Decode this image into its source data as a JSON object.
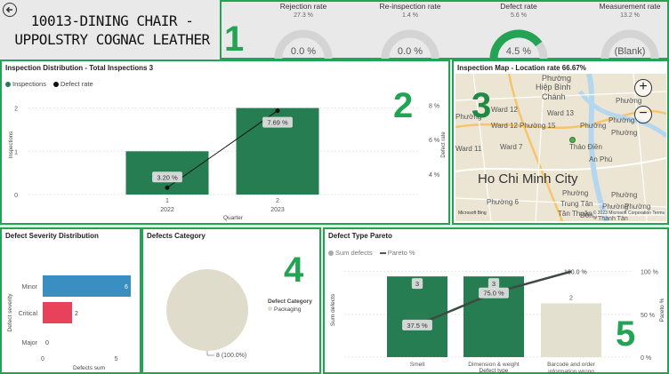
{
  "header": {
    "title_line1": "10013-DINING CHAIR -",
    "title_line2": "UPPOLSTRY COGNAC LEATHER"
  },
  "markers": [
    "1",
    "2",
    "3",
    "4",
    "5"
  ],
  "kpis": [
    {
      "label": "Rejection rate",
      "max": "27.3 %",
      "value": "0.0 %",
      "fill": 0
    },
    {
      "label": "Re-inspection rate",
      "max": "1.4 %",
      "value": "0.0 %",
      "fill": 0
    },
    {
      "label": "Defect rate",
      "max": "5.6 %",
      "value": "4.5 %",
      "fill": 0.8
    },
    {
      "label": "Measurement rate",
      "max": "13.2 %",
      "value": "(Blank)",
      "fill": 0
    }
  ],
  "colors": {
    "accent": "#22a454",
    "bar_green": "#267d52",
    "minor": "#3a8fc2",
    "critical": "#e8415a",
    "pie": "#e0dccb"
  },
  "inspection": {
    "title": "Inspection Distribution - Total Inspections 3",
    "legend": [
      "Inspections",
      "Defect rate"
    ],
    "xlabel": "Quarter",
    "ylabel_left": "Inspections",
    "ylabel_right": "Defect rate"
  },
  "map": {
    "title": "Inspection Map - Location rate 66.67%",
    "labels": [
      "Phường",
      "Hiệp Bình",
      "Chánh",
      "Phường",
      "Ward 12",
      "Ward 13",
      "Ward 12",
      "Phường",
      "Phường",
      "Phường",
      "Phường 15",
      "Phường",
      "Thảo Điền",
      "Ward 7",
      "An Phú",
      "Ward 11",
      "Ho Chi Minh City",
      "Phường",
      "Trung Tân",
      "Phường",
      "Phường 6",
      "Tân Thuận",
      "Đông",
      "Phường",
      "Phường",
      "Thành Tân"
    ],
    "attribution": "© 2023 Microsoft Corporation Terms",
    "bing": "Microsoft Bing"
  },
  "severity": {
    "title": "Defect Severity Distribution",
    "ylabel": "Defect severity",
    "xlabel": "Defects sum"
  },
  "category": {
    "title": "Defects Category",
    "legend_title": "Defect Category",
    "legend_item": "Packaging",
    "slice_label": "8 (100.0%)"
  },
  "pareto": {
    "title": "Defect Type Pareto",
    "legend": [
      "Sum defects",
      "Pareto %"
    ],
    "ylabel_left": "Sum defects",
    "ylabel_right": "Pareto %",
    "xlabel": "Defect type"
  },
  "chart_data": [
    {
      "type": "bar",
      "name": "Inspection Distribution",
      "categories": [
        "2022",
        "2023"
      ],
      "category_top": [
        "1",
        "2"
      ],
      "series": [
        {
          "name": "Inspections",
          "values": [
            1,
            2
          ]
        },
        {
          "name": "Defect rate",
          "values": [
            3.2,
            7.69
          ],
          "labels": [
            "3.20 %",
            "7.69 %"
          ],
          "axis": "right"
        }
      ],
      "ylim": [
        0,
        2.3
      ],
      "yticks": [
        0,
        1,
        2
      ],
      "y2lim": [
        2.8,
        8.6
      ],
      "y2ticks": [
        4,
        6,
        8
      ],
      "y2tick_labels": [
        "4 %",
        "6 %",
        "8 %"
      ]
    },
    {
      "type": "bar",
      "name": "Defect Severity Distribution",
      "orientation": "horizontal",
      "categories": [
        "Minor",
        "Critical",
        "Major"
      ],
      "values": [
        6,
        2,
        0
      ],
      "xlim": [
        0,
        6.3
      ],
      "xticks": [
        0,
        5
      ]
    },
    {
      "type": "pie",
      "name": "Defects Category",
      "categories": [
        "Packaging"
      ],
      "values": [
        8
      ]
    },
    {
      "type": "bar",
      "name": "Defect Type Pareto",
      "categories": [
        "Smell",
        "Dimension & weight",
        "Barcode and order information wrong"
      ],
      "series": [
        {
          "name": "Sum defects",
          "values": [
            3,
            3,
            2
          ]
        },
        {
          "name": "Pareto %",
          "values": [
            37.5,
            75.0,
            100.0
          ],
          "labels": [
            "37.5 %",
            "75.0 %",
            "100.0 %"
          ],
          "axis": "right"
        }
      ],
      "ylim": [
        0,
        3.5
      ],
      "y2lim": [
        0,
        110
      ],
      "y2ticks": [
        0,
        50,
        100
      ],
      "y2tick_labels": [
        "0 %",
        "50 %",
        "100 %"
      ]
    }
  ]
}
